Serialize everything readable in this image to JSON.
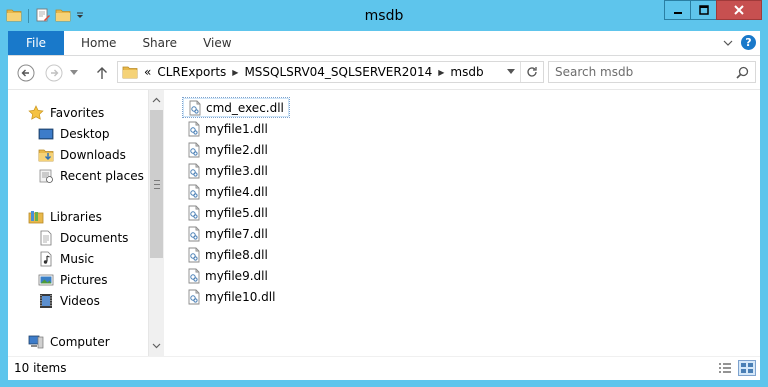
{
  "window": {
    "title": "msdb",
    "colors": {
      "frame": "#5ec5ec",
      "file_tab": "#1979ca",
      "close_button": "#c75050"
    }
  },
  "ribbon": {
    "file_tab": "File",
    "tabs": [
      {
        "label": "Home"
      },
      {
        "label": "Share"
      },
      {
        "label": "View"
      }
    ],
    "help_label": "?"
  },
  "address": {
    "overflow": "«",
    "crumbs": [
      {
        "label": "CLRExports"
      },
      {
        "label": "MSSQLSRV04_SQLSERVER2014"
      },
      {
        "label": "msdb"
      }
    ]
  },
  "search": {
    "placeholder": "Search msdb"
  },
  "nav": {
    "favorites": {
      "label": "Favorites",
      "items": [
        {
          "label": "Desktop"
        },
        {
          "label": "Downloads"
        },
        {
          "label": "Recent places"
        }
      ]
    },
    "libraries": {
      "label": "Libraries",
      "items": [
        {
          "label": "Documents"
        },
        {
          "label": "Music"
        },
        {
          "label": "Pictures"
        },
        {
          "label": "Videos"
        }
      ]
    },
    "computer": {
      "label": "Computer"
    }
  },
  "files": [
    {
      "name": "cmd_exec.dll",
      "icon": "dll-file-icon",
      "selected": true
    },
    {
      "name": "myfile1.dll",
      "icon": "dll-file-icon"
    },
    {
      "name": "myfile2.dll",
      "icon": "dll-file-icon"
    },
    {
      "name": "myfile3.dll",
      "icon": "dll-file-icon"
    },
    {
      "name": "myfile4.dll",
      "icon": "dll-file-icon"
    },
    {
      "name": "myfile5.dll",
      "icon": "dll-file-icon"
    },
    {
      "name": "myfile7.dll",
      "icon": "dll-file-icon"
    },
    {
      "name": "myfile8.dll",
      "icon": "dll-file-icon"
    },
    {
      "name": "myfile9.dll",
      "icon": "dll-file-icon"
    },
    {
      "name": "myfile10.dll",
      "icon": "dll-file-icon"
    }
  ],
  "status": {
    "count": "10 items"
  }
}
